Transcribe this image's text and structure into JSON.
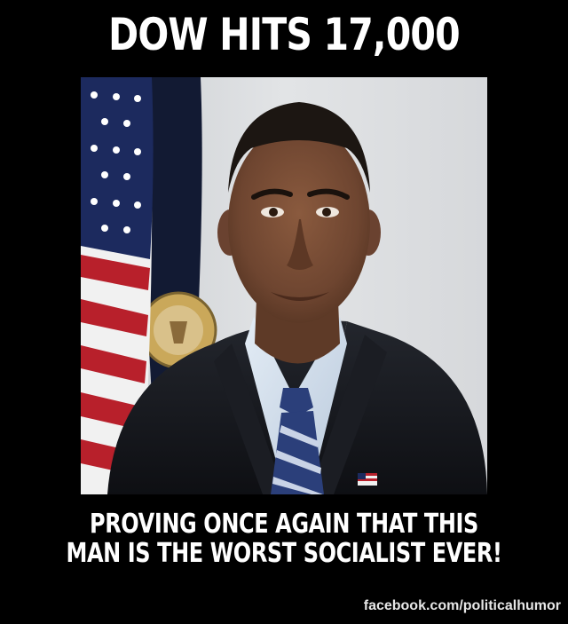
{
  "meme": {
    "headline": "DOW HITS 17,000",
    "caption_line1": "PROVING ONCE AGAIN THAT THIS",
    "caption_line2": "MAN IS THE WORST SOCIALIST EVER!",
    "credit": "facebook.com/politicalhumor"
  },
  "colors": {
    "background": "#000000",
    "text": "#ffffff",
    "photo_backdrop": "#d8dadd",
    "suit": "#15171c",
    "shirt": "#cfdcea",
    "tie": "#2b3f7a",
    "flag_red": "#b8202b",
    "flag_blue": "#1c2a5e"
  },
  "icons": [
    "american-flag-icon",
    "flag-lapel-pin-icon",
    "presidential-seal-icon"
  ]
}
